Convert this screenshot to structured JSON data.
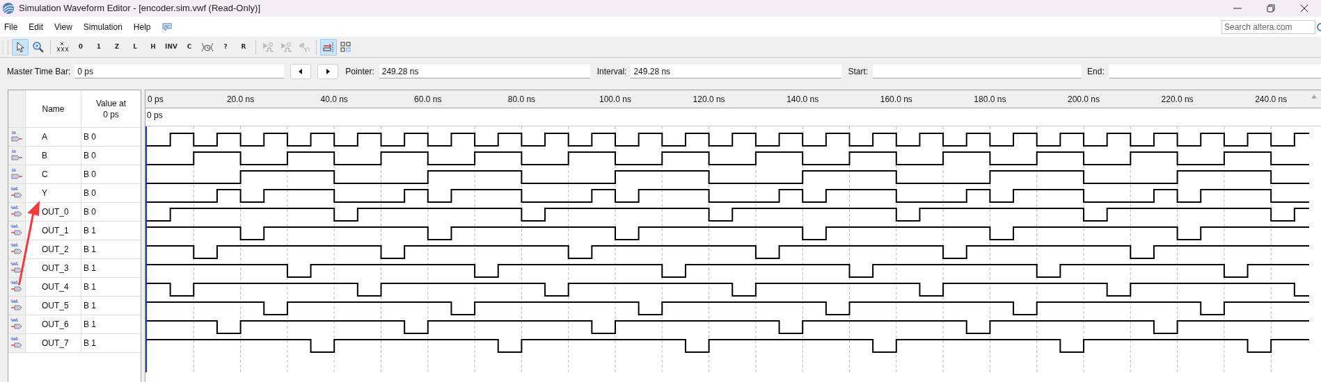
{
  "window": {
    "title": "Simulation Waveform Editor - [encoder.sim.vwf (Read-Only)]"
  },
  "menu": [
    "File",
    "Edit",
    "View",
    "Simulation",
    "Help"
  ],
  "search": {
    "placeholder": "Search altera.com"
  },
  "toolbar": [
    {
      "kind": "pointer",
      "selected": true
    },
    {
      "kind": "zoom",
      "selected": false
    },
    {
      "kind": "sep"
    },
    {
      "kind": "unknown",
      "selected": false
    },
    {
      "kind": "glyph",
      "glyph": "0",
      "selected": false
    },
    {
      "kind": "glyph",
      "glyph": "1",
      "selected": false
    },
    {
      "kind": "glyph",
      "glyph": "Z",
      "selected": false
    },
    {
      "kind": "glyph",
      "glyph": "L",
      "selected": false
    },
    {
      "kind": "glyph",
      "glyph": "H",
      "selected": false
    },
    {
      "kind": "glyph",
      "glyph": "INV",
      "selected": false
    },
    {
      "kind": "glyph",
      "glyph": "C",
      "selected": false
    },
    {
      "kind": "clock",
      "selected": false
    },
    {
      "kind": "glyph",
      "glyph": "?",
      "selected": false
    },
    {
      "kind": "glyph",
      "glyph": "R",
      "selected": false
    },
    {
      "kind": "sep"
    },
    {
      "kind": "run",
      "selected": false
    },
    {
      "kind": "run",
      "selected": false
    },
    {
      "kind": "hammer",
      "selected": false
    },
    {
      "kind": "sep"
    },
    {
      "kind": "snap",
      "selected": true
    },
    {
      "kind": "grid",
      "selected": false
    }
  ],
  "time_bar": {
    "master_label": "Master Time Bar:",
    "master_value": "0 ps",
    "pointer_label": "Pointer:",
    "pointer_value": "249.28 ns",
    "interval_label": "Interval:",
    "interval_value": "249.28 ns",
    "start_label": "Start:",
    "end_label": "End:"
  },
  "table": {
    "columns": [
      "Name",
      "Value at\n0 ps"
    ],
    "signals": [
      {
        "kind": "in",
        "name": "A",
        "value": "B 0"
      },
      {
        "kind": "in",
        "name": "B",
        "value": "B 0"
      },
      {
        "kind": "in",
        "name": "C",
        "value": "B 0"
      },
      {
        "kind": "out",
        "name": "Y",
        "value": "B 0"
      },
      {
        "kind": "out",
        "name": "OUT_0",
        "value": "B 0"
      },
      {
        "kind": "out",
        "name": "OUT_1",
        "value": "B 1"
      },
      {
        "kind": "out",
        "name": "OUT_2",
        "value": "B 1"
      },
      {
        "kind": "out",
        "name": "OUT_3",
        "value": "B 1"
      },
      {
        "kind": "out",
        "name": "OUT_4",
        "value": "B 1"
      },
      {
        "kind": "out",
        "name": "OUT_5",
        "value": "B 1"
      },
      {
        "kind": "out",
        "name": "OUT_6",
        "value": "B 1"
      },
      {
        "kind": "out",
        "name": "OUT_7",
        "value": "B 1"
      }
    ]
  },
  "ruler": {
    "ticks": [
      "0 ps",
      "20.0 ns",
      "40.0 ns",
      "60.0 ns",
      "80.0 ns",
      "100.0 ns",
      "120.0 ns",
      "140.0 ns",
      "160.0 ns",
      "180.0 ns",
      "200.0 ns",
      "220.0 ns",
      "240.0 ns"
    ],
    "time_marker": "0 ps"
  }
}
